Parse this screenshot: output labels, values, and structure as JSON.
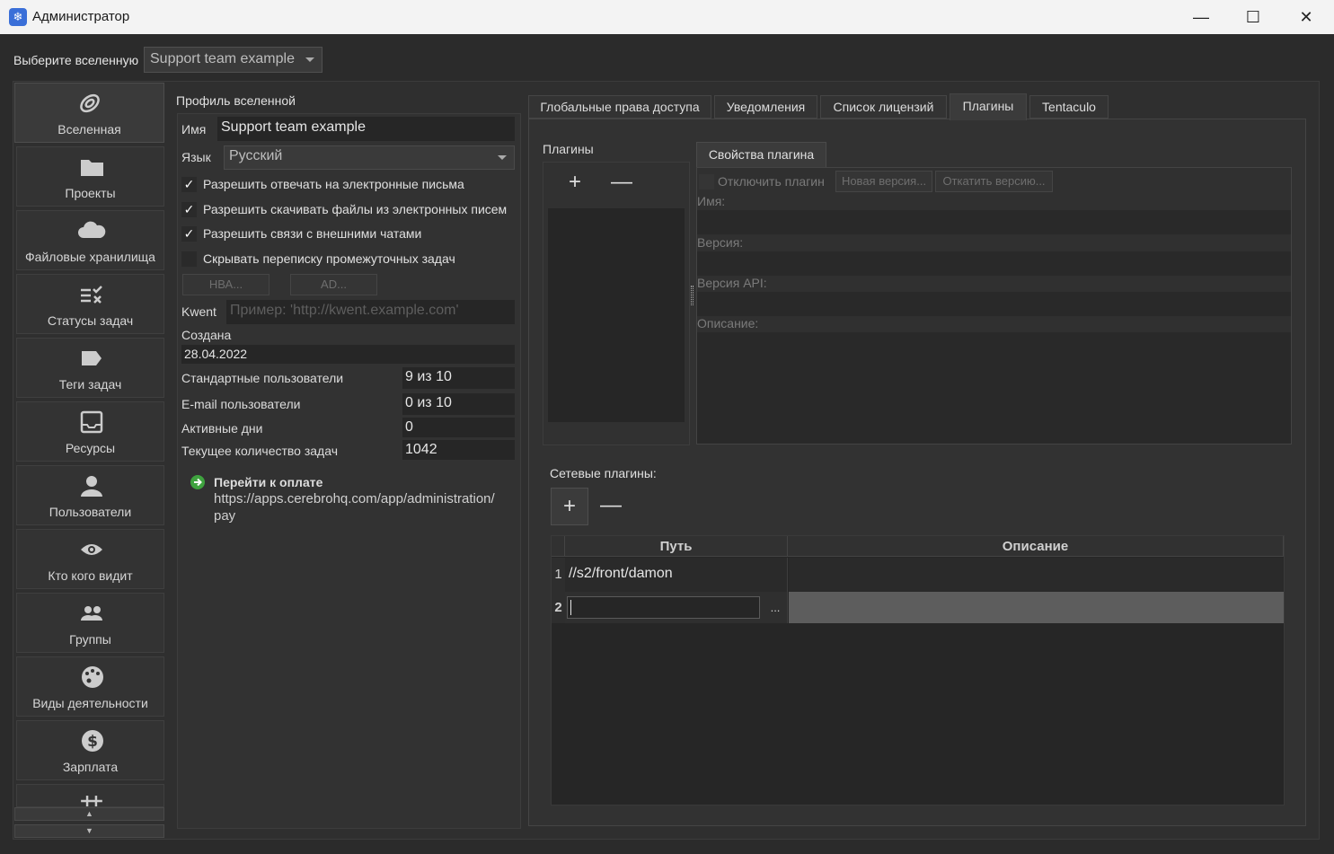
{
  "window": {
    "title": "Администратор",
    "minimize": "—",
    "maximize": "☐",
    "close": "✕"
  },
  "universe": {
    "label": "Выберите вселенную",
    "selected": "Support team example"
  },
  "sidebar": {
    "items": [
      {
        "label": "Вселенная",
        "icon": "spiral-icon"
      },
      {
        "label": "Проекты",
        "icon": "folder-icon"
      },
      {
        "label": "Файловые хранилища",
        "icon": "cloud-icon"
      },
      {
        "label": "Статусы задач",
        "icon": "checklist-icon"
      },
      {
        "label": "Теги задач",
        "icon": "tag-icon"
      },
      {
        "label": "Ресурсы",
        "icon": "inbox-icon"
      },
      {
        "label": "Пользователи",
        "icon": "person-icon"
      },
      {
        "label": "Кто кого видит",
        "icon": "eye-icon"
      },
      {
        "label": "Группы",
        "icon": "group-icon"
      },
      {
        "label": "Виды деятельности",
        "icon": "palette-icon"
      },
      {
        "label": "Зарплата",
        "icon": "dollar-icon"
      }
    ]
  },
  "profile": {
    "title": "Профиль вселенной",
    "name_label": "Имя",
    "name_value": "Support team example",
    "lang_label": "Язык",
    "lang_value": "Русский",
    "checks": [
      {
        "label": "Разрешить отвечать на электронные письма",
        "checked": true
      },
      {
        "label": "Разрешить скачивать файлы из электронных писем",
        "checked": true
      },
      {
        "label": "Разрешить связи с внешними чатами",
        "checked": true
      },
      {
        "label": "Скрывать переписку промежуточных задач",
        "checked": false
      }
    ],
    "btn_hba": "НВА...",
    "btn_ad": "AD...",
    "kwent_label": "Kwent",
    "kwent_placeholder": "Пример: 'http://kwent.example.com'",
    "created_label": "Создана",
    "created_value": "28.04.2022",
    "std_users_label": "Стандартные пользователи",
    "std_users_value": "9 из 10",
    "email_users_label": "E-mail пользователи",
    "email_users_value": "0 из 10",
    "active_days_label": "Активные дни",
    "active_days_value": "0",
    "tasks_label": "Текущее количество задач",
    "tasks_value": "1042",
    "pay_title": "Перейти к оплате",
    "pay_url_1": "https://apps.cerebrohq.com/app/administration/",
    "pay_url_2": "pay"
  },
  "tabs": [
    "Глобальные права доступа",
    "Уведомления",
    "Список лицензий",
    "Плагины",
    "Tentaculo"
  ],
  "plugins": {
    "list_label": "Плагины",
    "add": "+",
    "remove": "—",
    "props_tab": "Свойства плагина",
    "disable_label": "Отключить плагин",
    "new_version": "Новая версия...",
    "rollback": "Откатить версию...",
    "name_label": "Имя:",
    "version_label": "Версия:",
    "api_label": "Версия API:",
    "desc_label": "Описание:"
  },
  "net_plugins": {
    "label": "Сетевые плагины:",
    "add": "+",
    "remove": "—",
    "col_path": "Путь",
    "col_desc": "Описание",
    "rows": [
      {
        "num": "1",
        "path": "//s2/front/damon",
        "desc": ""
      },
      {
        "num": "2",
        "path": "",
        "desc": ""
      }
    ],
    "browse": "..."
  }
}
